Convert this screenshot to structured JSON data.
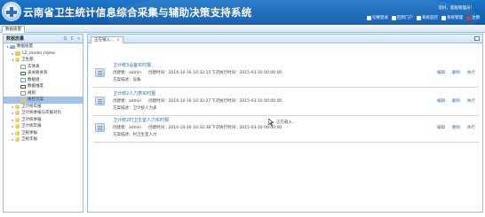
{
  "header": {
    "title": "云南省卫生统计信息综合采集与辅助决策支持系统",
    "welcome": "您好，超级管理员！",
    "nav": [
      {
        "label": "切换登录",
        "icon": "switch-icon"
      },
      {
        "label": "回到门户",
        "icon": "home-icon"
      },
      {
        "label": "系统监控",
        "icon": "monitor-icon"
      },
      {
        "label": "系统管理",
        "icon": "gear-icon"
      },
      {
        "label": "注销",
        "icon": "exit-icon"
      }
    ]
  },
  "module_tab": {
    "label": "数据质量"
  },
  "sidebar": {
    "title": "数据质量",
    "tools": [
      "Q",
      "C",
      "«"
    ],
    "tree": [
      {
        "toggle": "▾",
        "icon": "db",
        "label": "数据质量",
        "indent": 0
      },
      {
        "toggle": "▸",
        "icon": "folder",
        "label": "LZ_model_name",
        "indent": 1
      },
      {
        "toggle": "▾",
        "icon": "gold",
        "label": "卫生部",
        "indent": 1
      },
      {
        "toggle": "",
        "icon": "table",
        "label": "实体表",
        "indent": 2
      },
      {
        "toggle": "",
        "icon": "rel",
        "label": "表关联关系",
        "indent": 2
      },
      {
        "toggle": "",
        "icon": "table",
        "label": "数据组",
        "indent": 2
      },
      {
        "toggle": "",
        "icon": "dice",
        "label": "数据维度",
        "indent": 2
      },
      {
        "toggle": "",
        "icon": "table",
        "label": "规则",
        "indent": 2
      },
      {
        "toggle": "",
        "icon": "folder",
        "label": "质控方案",
        "indent": 2,
        "selected": true
      },
      {
        "toggle": "▸",
        "icon": "gold",
        "label": "卫计统年报",
        "indent": 1
      },
      {
        "toggle": "▸",
        "icon": "gold",
        "label": "卫计统季报与年报对比",
        "indent": 1
      },
      {
        "toggle": "▸",
        "icon": "gold",
        "label": "卫计统季报",
        "indent": 1
      },
      {
        "toggle": "▸",
        "icon": "gold",
        "label": "卫计统年报",
        "indent": 1
      },
      {
        "toggle": "▸",
        "icon": "gold",
        "label": "卫统季报",
        "indent": 1
      },
      {
        "toggle": "▸",
        "icon": "gold",
        "label": "卫统年报",
        "indent": 1
      }
    ]
  },
  "content": {
    "tab_label": "正在铺入...",
    "tab_close": "×",
    "cards": [
      {
        "name": "卫计统3设备实时报",
        "creator": "创建者：admin",
        "created": "创建时间：2014-10-16 10:32:15",
        "next": "下次执行时间：2015-03-10 00:00:00",
        "desc": "方案描述：设备",
        "actions": [
          "编辑",
          "删除",
          "执行"
        ]
      },
      {
        "name": "卫计统2人力表实时报",
        "creator": "创建者：admin",
        "created": "创建时间：2014-10-16 10:32:27",
        "next": "下次执行时间：2015-03-10 00:00:00",
        "desc": "方案描述：卫计统人力表",
        "actions": [
          "编辑",
          "删除",
          "执行"
        ]
      },
      {
        "name": "卫计统2村卫生室人力实时报",
        "creator": "创建者：admin",
        "created": "创建时间：2014-10-16 10:32:38",
        "next": "下次执行时间：2015-03-10 00:00:00",
        "desc": "方案描述：村卫生室人力",
        "actions": [
          "编辑",
          "删除",
          "执行"
        ]
      }
    ],
    "tooltip": "正在载入..."
  }
}
